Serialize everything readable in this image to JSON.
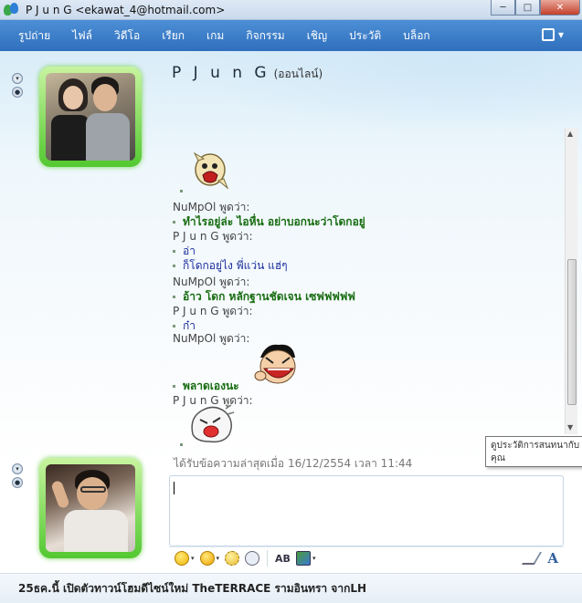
{
  "window": {
    "title": "P J u n G <ekawat_4@hotmail.com>",
    "minimize": "─",
    "maximize": "□",
    "close": "✕"
  },
  "menu": {
    "items": [
      "รูปถ่าย",
      "ไฟล์",
      "วิดีโอ",
      "เรียก",
      "เกม",
      "กิจกรรม",
      "เชิญ",
      "ประวัติ",
      "บล็อก"
    ],
    "options_icon": "options-menu-icon",
    "options_arrow": "▾"
  },
  "contact": {
    "name": "P J u n G",
    "status": "(ออนไลน์)"
  },
  "chat": {
    "lines": [
      {
        "type": "sender",
        "text": "NuMpOl พูดว่า:"
      },
      {
        "type": "msg",
        "text": "ทำไรอยู่ล่ะ ไอหื่น อย่าบอกนะว่าโดกอยู่",
        "color": "green"
      },
      {
        "type": "sender",
        "text": "P J u n G พูดว่า:"
      },
      {
        "type": "msg",
        "text": "อ่า",
        "color": "blue"
      },
      {
        "type": "msg",
        "text": "ก็โดกอยู่ไง พี่แว่น แฮ่ๆ",
        "color": "blue"
      },
      {
        "type": "sender",
        "text": "NuMpOl พูดว่า:"
      },
      {
        "type": "msg",
        "text": "อ้าว โดก หลักฐานชัดเจน เซฟฟฟฟฟ",
        "color": "green"
      },
      {
        "type": "sender",
        "text": "P J u n G พูดว่า:"
      },
      {
        "type": "msg",
        "text": "ก๋า",
        "color": "blue"
      },
      {
        "type": "sender",
        "text": "NuMpOl พูดว่า:"
      },
      {
        "type": "msg",
        "text": "พลาดเองนะ",
        "color": "green"
      },
      {
        "type": "sender",
        "text": "P J u n G พูดว่า:"
      }
    ],
    "last_received": "ได้รับข้อความล่าสุดเมื่อ 16/12/2554 เวลา 11:44",
    "tooltip": "ดูประวัติการสนทนากับคุณ",
    "scroll_up": "▲",
    "scroll_down": "▼"
  },
  "toolbar": {
    "font_label": "A",
    "spell_label": "AB",
    "dropdown_arrow": "▾"
  },
  "ad": {
    "text": "25ธค.นี้ เปิดตัวทาวน์โฮมดีไซน์ใหม่ TheTERRACE รามอินทรา จากLH"
  },
  "colors": {
    "menubar": "#2f6fbd",
    "avatar_frame": "#52c830",
    "green_message": "#176c10",
    "blue_message": "#1b2f9e"
  }
}
